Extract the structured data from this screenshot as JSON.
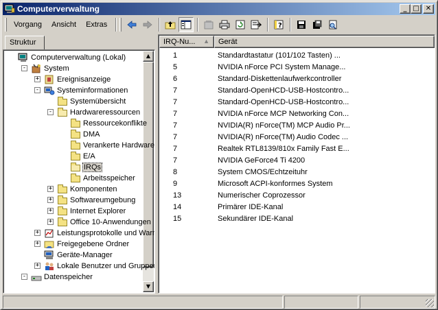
{
  "window": {
    "title": "Computerverwaltung",
    "minimize_glyph": "_",
    "maximize_glyph": "□",
    "close_glyph": "✕"
  },
  "menu": {
    "items": [
      {
        "label": "Vorgang"
      },
      {
        "label": "Ansicht"
      },
      {
        "label": "Extras"
      }
    ]
  },
  "toolbar": {
    "icons": [
      "back-arrow-icon",
      "forward-arrow-icon",
      "up-folder-icon",
      "show-hide-tree-icon",
      "properties-icon",
      "print-icon",
      "refresh-icon",
      "export-list-icon",
      "help-icon",
      "save-icon",
      "print-preview-icon",
      "find-icon"
    ]
  },
  "left_pane": {
    "tab_label": "Struktur",
    "tree": [
      {
        "label": "Computerverwaltung (Lokal)",
        "icon": "computer-management-icon",
        "level": 0,
        "expander": ""
      },
      {
        "label": "System",
        "icon": "system-tools-icon",
        "level": 1,
        "expander": "-"
      },
      {
        "label": "Ereignisanzeige",
        "icon": "event-viewer-icon",
        "level": 2,
        "expander": "+"
      },
      {
        "label": "Systeminformationen",
        "icon": "system-information-icon",
        "level": 2,
        "expander": "-"
      },
      {
        "label": "Systemübersicht",
        "icon": "folder-icon",
        "level": 3,
        "expander": ""
      },
      {
        "label": "Hardwareressourcen",
        "icon": "folder-open-icon",
        "level": 3,
        "expander": "-"
      },
      {
        "label": "Ressourcekonflikte",
        "icon": "folder-icon",
        "level": 4,
        "expander": ""
      },
      {
        "label": "DMA",
        "icon": "folder-icon",
        "level": 4,
        "expander": ""
      },
      {
        "label": "Verankerte Hardware",
        "icon": "folder-icon",
        "level": 4,
        "expander": ""
      },
      {
        "label": "E/A",
        "icon": "folder-icon",
        "level": 4,
        "expander": ""
      },
      {
        "label": "IRQs",
        "icon": "folder-open-icon",
        "level": 4,
        "expander": "",
        "selected": true
      },
      {
        "label": "Arbeitsspeicher",
        "icon": "folder-icon",
        "level": 4,
        "expander": ""
      },
      {
        "label": "Komponenten",
        "icon": "folder-icon",
        "level": 3,
        "expander": "+"
      },
      {
        "label": "Softwareumgebung",
        "icon": "folder-icon",
        "level": 3,
        "expander": "+"
      },
      {
        "label": "Internet Explorer",
        "icon": "folder-icon",
        "level": 3,
        "expander": "+"
      },
      {
        "label": "Office 10-Anwendungen",
        "icon": "folder-icon",
        "level": 3,
        "expander": "+"
      },
      {
        "label": "Leistungsprotokolle und Warn",
        "icon": "performance-logs-icon",
        "level": 2,
        "expander": "+"
      },
      {
        "label": "Freigegebene Ordner",
        "icon": "shared-folder-icon",
        "level": 2,
        "expander": "+"
      },
      {
        "label": "Geräte-Manager",
        "icon": "device-manager-icon",
        "level": 2,
        "expander": ""
      },
      {
        "label": "Lokale Benutzer und Gruppen",
        "icon": "users-groups-icon",
        "level": 2,
        "expander": "+"
      },
      {
        "label": "Datenspeicher",
        "icon": "storage-icon",
        "level": 1,
        "expander": "-"
      }
    ]
  },
  "list": {
    "columns": [
      {
        "label": "IRQ-Nu...",
        "sort": "▲"
      },
      {
        "label": "Gerät"
      }
    ],
    "rows": [
      {
        "irq": "1",
        "device": "Standardtastatur (101/102 Tasten) ..."
      },
      {
        "irq": "5",
        "device": "NVIDIA nForce PCI System Manage..."
      },
      {
        "irq": "6",
        "device": "Standard-Diskettenlaufwerkcontroller"
      },
      {
        "irq": "7",
        "device": "Standard-OpenHCD-USB-Hostcontro..."
      },
      {
        "irq": "7",
        "device": "Standard-OpenHCD-USB-Hostcontro..."
      },
      {
        "irq": "7",
        "device": "NVIDIA nForce MCP Networking Con..."
      },
      {
        "irq": "7",
        "device": "NVIDIA(R) nForce(TM) MCP Audio Pr..."
      },
      {
        "irq": "7",
        "device": "NVIDIA(R) nForce(TM) Audio Codec ..."
      },
      {
        "irq": "7",
        "device": "Realtek RTL8139/810x Family Fast E..."
      },
      {
        "irq": "7",
        "device": "NVIDIA GeForce4 Ti 4200"
      },
      {
        "irq": "8",
        "device": "System CMOS/Echtzeituhr"
      },
      {
        "irq": "9",
        "device": "Microsoft ACPI-konformes System"
      },
      {
        "irq": "13",
        "device": "Numerischer Coprozessor"
      },
      {
        "irq": "14",
        "device": "Primärer IDE-Kanal"
      },
      {
        "irq": "15",
        "device": "Sekundärer IDE-Kanal"
      }
    ]
  },
  "scrollbar": {
    "up_glyph": "▲",
    "down_glyph": "▼"
  },
  "colors": {
    "title_start": "#0a246a",
    "title_end": "#a6caf0",
    "face": "#d4d0c8"
  }
}
